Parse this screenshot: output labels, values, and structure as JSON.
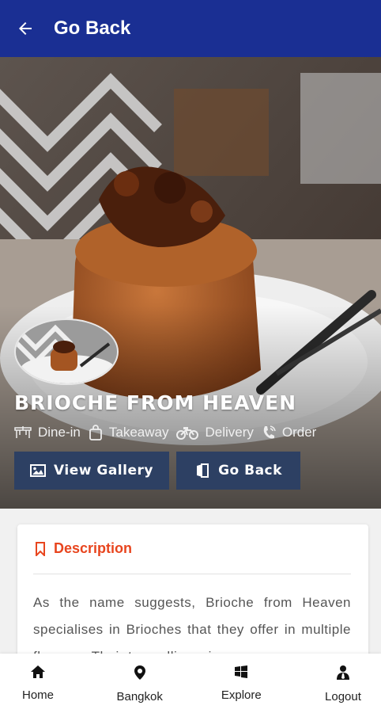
{
  "header": {
    "title": "Go Back",
    "back_icon": "arrow-left-icon"
  },
  "restaurant": {
    "name": "BRIOCHE FROM HEAVEN",
    "services": [
      {
        "label": "Dine-in",
        "icon": "dining-icon"
      },
      {
        "label": "Takeaway",
        "icon": "shopping-bag-icon"
      },
      {
        "label": "Delivery",
        "icon": "motorcycle-icon"
      },
      {
        "label": "Order",
        "icon": "phone-icon"
      }
    ]
  },
  "actions": {
    "gallery_label": "View Gallery",
    "goback_label": "Go Back"
  },
  "description": {
    "title": "Description",
    "text": "As the name suggests, Brioche from Heaven specialises in Brioches that they offer in multiple flavours. Their top selling, cinnamon"
  },
  "bottom_nav": [
    {
      "label": "Home",
      "icon": "home-icon"
    },
    {
      "label": "Bangkok",
      "icon": "map-pin-icon"
    },
    {
      "label": "Explore",
      "icon": "windows-icon"
    },
    {
      "label": "Logout",
      "icon": "user-icon"
    }
  ],
  "colors": {
    "header": "#1a2f93",
    "accent": "#e8451e",
    "button": "#2d4063"
  }
}
